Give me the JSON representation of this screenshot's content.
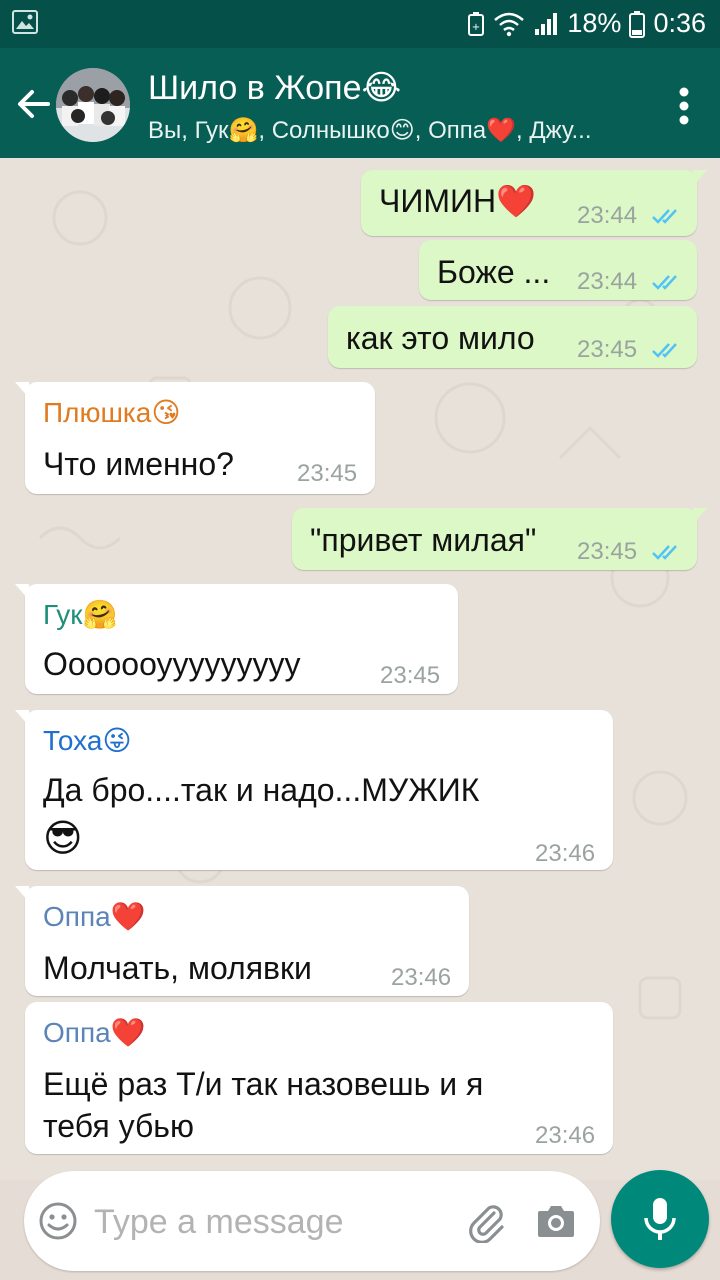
{
  "status_bar": {
    "battery": "18%",
    "time": "0:36"
  },
  "header": {
    "title": "Шило в Жопе😂",
    "members": "Вы, Гук🤗, Солнышко😊, Оппа❤️, Джу..."
  },
  "messages": [
    {
      "dir": "out",
      "text": "ЧИМИН❤️",
      "time": "23:44"
    },
    {
      "dir": "out",
      "text": "Боже ...",
      "time": "23:44"
    },
    {
      "dir": "out",
      "text": "как это мило",
      "time": "23:45"
    },
    {
      "dir": "in",
      "sender": "Плюшка😘",
      "text": "Что именно?",
      "time": "23:45"
    },
    {
      "dir": "out",
      "text": "\"привет милая\"",
      "time": "23:45"
    },
    {
      "dir": "in",
      "sender": "Гук🤗",
      "text": "Ооооооууууууууу",
      "time": "23:45"
    },
    {
      "dir": "in",
      "sender": "Тоха😜",
      "text_line1": "Да бро....так и надо...МУЖИК",
      "text_line2": "😎",
      "time": "23:46"
    },
    {
      "dir": "in",
      "sender": "Оппа❤️",
      "text": "Молчать, молявки",
      "time": "23:46"
    },
    {
      "dir": "in",
      "sender": "Оппа❤️",
      "text_line1": "Ещё раз Т/и так назовешь и я",
      "text_line2": "тебя убью",
      "time": "23:46"
    }
  ],
  "input": {
    "placeholder": "Type a message"
  },
  "colors": {
    "toolbar": "#075e54",
    "status_bar": "#05514a",
    "outgoing_bubble": "#dcf8c6",
    "incoming_bubble": "#ffffff",
    "read_ticks": "#4fc3f7",
    "sender_plushka": "#e07b1f",
    "sender_guk": "#1f8f7a",
    "sender_toha": "#1e6fd0",
    "sender_oppa": "#5b84b8",
    "fab": "#00897b"
  },
  "icons": [
    "gallery-icon",
    "battery-saver-icon",
    "wifi-icon",
    "signal-icon",
    "battery-icon",
    "back-arrow-icon",
    "more-vert-icon",
    "double-check-icon",
    "emoji-icon",
    "paperclip-icon",
    "camera-icon",
    "mic-icon"
  ]
}
